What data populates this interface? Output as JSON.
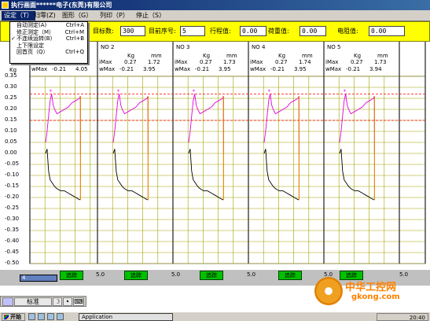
{
  "window": {
    "title": "执行画面******电子(东莞)有限公司"
  },
  "menu": {
    "items": [
      {
        "label": "设定（T）",
        "active": true
      },
      {
        "label": "归零(Z)"
      },
      {
        "label": "图形（G）"
      },
      {
        "label": "列印（P）"
      },
      {
        "label": "停止（S）"
      }
    ]
  },
  "dropdown": {
    "items": [
      {
        "label": "自动测定(A)",
        "shortcut": "Ctrl+A",
        "checked": false
      },
      {
        "label": "修正测定（M）",
        "shortcut": "Ctrl+M",
        "checked": false
      },
      {
        "label": "不连续运转(B)",
        "shortcut": "Ctrl+B",
        "checked": true
      },
      {
        "label": "上下限设定",
        "shortcut": "",
        "checked": false
      },
      {
        "label": "回首页（Q）",
        "shortcut": "Ctrl+Q",
        "checked": false
      }
    ]
  },
  "params": {
    "target_label": "目标数:",
    "target_value": "300",
    "seq_label": "目前序号:",
    "seq_value": "5",
    "stroke_label": "行程值:",
    "stroke_value": "0.00",
    "load_label": "荷重值:",
    "load_value": "0.00",
    "resistance_label": "电阻值:",
    "resistance_value": "0.00"
  },
  "chart_data": {
    "type": "line",
    "y_unit": "Kg",
    "yticks": [
      "0.35",
      "0.30",
      "0.25",
      "0.20",
      "0.15",
      "0.10",
      "0.05",
      "0.00",
      "-0.05",
      "-0.10",
      "-0.15",
      "-0.20",
      "-0.25",
      "-0.30",
      "-0.35",
      "-0.40",
      "-0.45",
      "-0.50"
    ],
    "ylim": [
      -0.5,
      0.35
    ],
    "upper_limit": 0.27,
    "lower_limit": 0.15,
    "panels": [
      {
        "no": "",
        "iMax_kg": "",
        "iMax_mm": "",
        "wMax_kg": "-0.21",
        "wMax_mm": "4.05",
        "unit_kg": "Kg",
        "unit_mm": "mm"
      },
      {
        "no": "NO 2",
        "iMax_kg": "0.27",
        "iMax_mm": "1.72",
        "wMax_kg": "-0.21",
        "wMax_mm": "3.95",
        "unit_kg": "Kg",
        "unit_mm": "mm"
      },
      {
        "no": "NO 3",
        "iMax_kg": "0.27",
        "iMax_mm": "1.73",
        "wMax_kg": "-0.21",
        "wMax_mm": "3.95",
        "unit_kg": "Kg",
        "unit_mm": "mm"
      },
      {
        "no": "NO 4",
        "iMax_kg": "0.27",
        "iMax_mm": "1.74",
        "wMax_kg": "-0.21",
        "wMax_mm": "3.95",
        "unit_kg": "Kg",
        "unit_mm": "mm"
      },
      {
        "no": "NO 5",
        "iMax_kg": "0.27",
        "iMax_mm": "1.73",
        "wMax_kg": "-0.21",
        "wMax_mm": "3.94",
        "unit_kg": "Kg",
        "unit_mm": "mm"
      }
    ],
    "curve": {
      "x": [
        0,
        0.2,
        0.4,
        0.6,
        0.8,
        1.0,
        1.2,
        1.5,
        2.0,
        2.5,
        3.0,
        3.5,
        4.0,
        4.5,
        4.6,
        4.62
      ],
      "up": [
        0.05,
        0.1,
        0.17,
        0.24,
        0.27,
        0.22,
        0.2,
        0.18,
        0.19,
        0.2,
        0.21,
        0.23,
        0.24,
        0.25,
        0.26,
        0.0
      ],
      "down": [
        0.0,
        0.02,
        -0.08,
        -0.12,
        -0.13,
        -0.14,
        -0.15,
        -0.16,
        -0.17,
        -0.17,
        -0.18,
        -0.19,
        -0.2,
        -0.21,
        -0.21,
        -0.21
      ]
    },
    "upper_color": "#e000e0",
    "lower_color": "#000000",
    "limit_color": "#ff0000",
    "grid_color": "#a0a000"
  },
  "track": {
    "buttons": [
      "追踪",
      "追踪",
      "追踪",
      "追踪",
      "追踪"
    ],
    "values": [
      "5.0",
      "5.0",
      "5.0",
      "5.0",
      "5.0"
    ],
    "status": "4"
  },
  "ime": {
    "mode": "标准",
    "moon": "☽",
    "dot": "•",
    "kbd": "⌨"
  },
  "taskbar": {
    "start": "开始",
    "app": "Application",
    "clock": "20:40"
  },
  "watermark": {
    "title": "中华工控网",
    "url": "gkong.com"
  }
}
